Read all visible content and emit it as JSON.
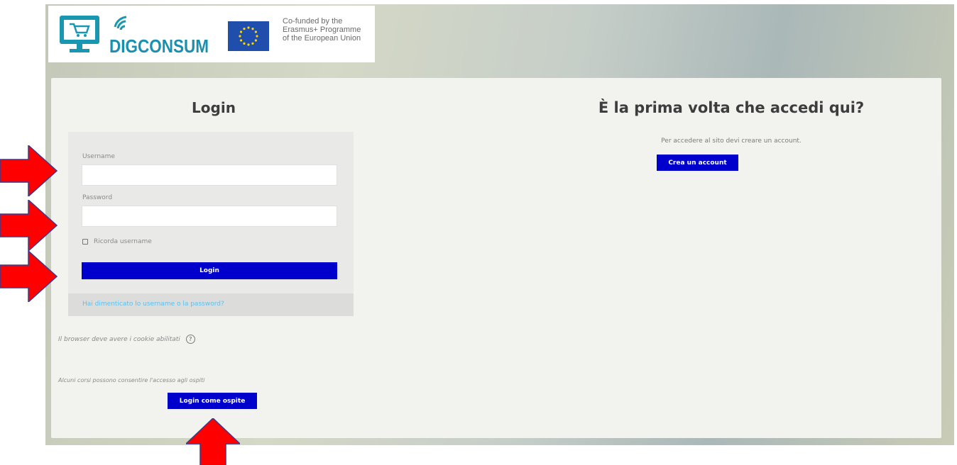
{
  "header": {
    "brand": "DIGCONSUM",
    "eu_text": [
      "Co-funded by the",
      "Erasmus+ Programme",
      "of the European Union"
    ]
  },
  "login": {
    "title": "Login",
    "username_label": "Username",
    "username_value": "",
    "password_label": "Password",
    "password_value": "",
    "remember_label": "Ricorda username",
    "login_button": "Login",
    "forgot_link": "Hai dimenticato lo username o la password?",
    "cookies_note": "Il browser deve avere i cookie abilitati",
    "guest_note": "Alcuni corsi possono consentire l'accesso agli ospiti",
    "guest_button": "Login come ospite"
  },
  "signup": {
    "title": "È la prima volta che accedi qui?",
    "description": "Per accedere al sito devi creare un account.",
    "create_button": "Crea un account"
  },
  "colors": {
    "primary_button": "#0000cc",
    "arrow": "#ff0000"
  },
  "icons": [
    "monitor-cart-icon",
    "wifi-icon",
    "eu-flag-icon",
    "help-icon",
    "red-arrow-icon"
  ]
}
